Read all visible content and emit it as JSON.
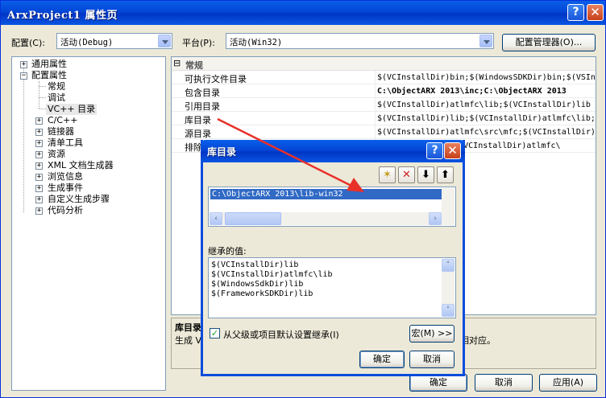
{
  "window": {
    "title": "ArxProject1 属性页",
    "help_glyph": "?",
    "close_glyph": "✕"
  },
  "toolbar": {
    "config_label": "配置(C):",
    "config_value": "活动(Debug)",
    "platform_label": "平台(P):",
    "platform_value": "活动(Win32)",
    "config_manager": "配置管理器(O)..."
  },
  "tree": {
    "pm_plus": "+",
    "pm_minus": "−",
    "items": [
      {
        "label": "通用属性"
      },
      {
        "label": "配置属性"
      },
      {
        "label": "常规"
      },
      {
        "label": "调试"
      },
      {
        "label": "VC++ 目录"
      },
      {
        "label": "C/C++"
      },
      {
        "label": "链接器"
      },
      {
        "label": "清单工具"
      },
      {
        "label": "资源"
      },
      {
        "label": "XML 文档生成器"
      },
      {
        "label": "浏览信息"
      },
      {
        "label": "生成事件"
      },
      {
        "label": "自定义生成步骤"
      },
      {
        "label": "代码分析"
      }
    ]
  },
  "grid": {
    "group_toggle": "⊟",
    "group": "常规",
    "rows": [
      {
        "name": "可执行文件目录",
        "value": "$(VCInstallDir)bin;$(WindowsSDKDir)bin;$(VSIn"
      },
      {
        "name": "包含目录",
        "value": "C:\\ObjectARX 2013\\inc;C:\\ObjectARX 2013"
      },
      {
        "name": "引用目录",
        "value": "$(VCInstallDir)atlmfc\\lib;$(VCInstallDir)lib"
      },
      {
        "name": "库目录",
        "value": "$(VCInstallDir)lib;$(VCInstallDir)atlmfc\\lib;"
      },
      {
        "name": "源目录",
        "value": "$(VCInstallDir)atlmfc\\src\\mfc;$(VCInstallDir)"
      },
      {
        "name": "排除",
        "value": "lude;$(VCInstallDir)atlmfc\\"
      }
    ]
  },
  "description": {
    "title": "库目录",
    "text_start": "生成 V",
    "text_end": "相对应。"
  },
  "footer": {
    "ok": "确定",
    "cancel": "取消",
    "apply": "应用(A)"
  },
  "dialog": {
    "title": "库目录",
    "help_glyph": "?",
    "close_glyph": "✕",
    "toolbar_glyphs": {
      "new": "✶",
      "delete": "✕",
      "down": "⬇",
      "up": "⬆"
    },
    "entry": "C:\\ObjectARX 2013\\lib-win32",
    "scroll_left": "‹",
    "scroll_right": "›",
    "scroll_up": "˄",
    "scroll_down": "˅",
    "inherited_label": "继承的值:",
    "inherited": [
      "$(VCInstallDir)lib",
      "$(VCInstallDir)atlmfc\\lib",
      "$(WindowsSdkDir)lib",
      "$(FrameworkSDKDir)lib"
    ],
    "inherit_check_mark": "✓",
    "inherit_checkbox": "从父级或项目默认设置继承(I)",
    "macro_button": "宏(M) >>",
    "ok": "确定",
    "cancel": "取消"
  },
  "colors": {
    "annotation_arrow": "#E8312A",
    "titlebar": "#0A5FEA",
    "selection": "#316AC5"
  }
}
